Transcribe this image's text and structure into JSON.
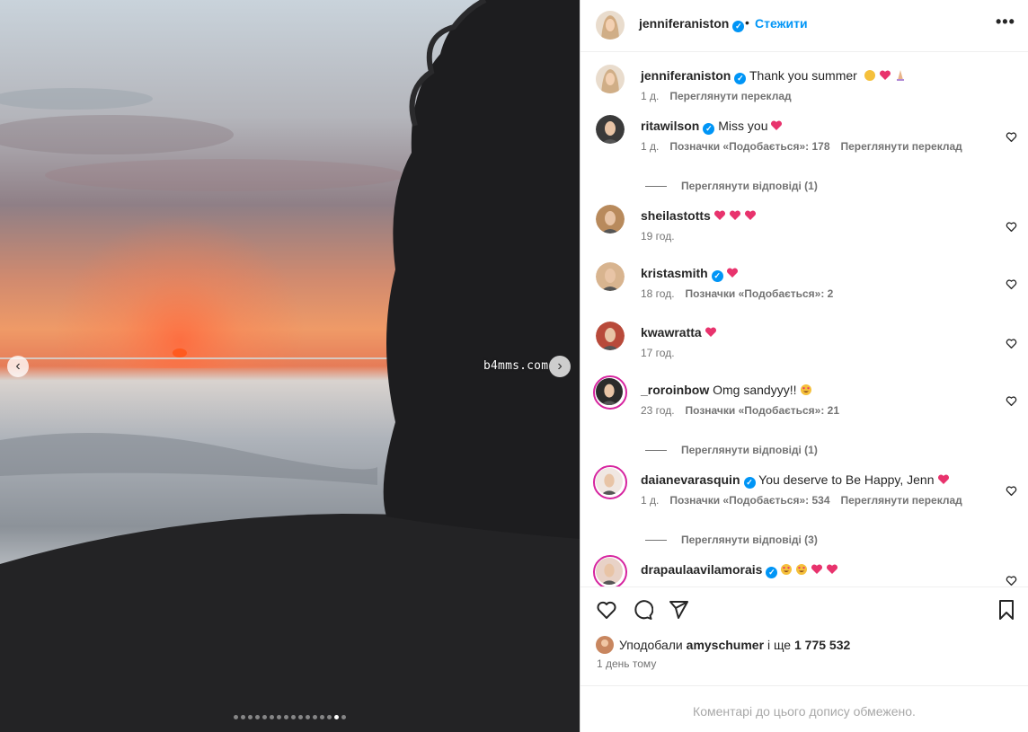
{
  "post": {
    "author": "jenniferaniston",
    "follow_label": "Стежити",
    "separator": "•",
    "more_label": "•••",
    "caption": "Thank you summer",
    "caption_time": "1 д.",
    "caption_translate": "Переглянути переклад"
  },
  "media": {
    "watermark": "b4mms.com",
    "prev_icon": "chevron-left-icon",
    "next_icon": "chevron-right-icon",
    "carousel_total": 16,
    "carousel_active": 15
  },
  "comments": [
    {
      "user": "ritawilson",
      "verified": true,
      "text": "Miss you",
      "emojis": [
        "heart"
      ],
      "time": "1 д.",
      "likes": "Позначки «Подобається»: 178",
      "translate": "Переглянути переклад",
      "replies": "Переглянути відповіді (1)"
    },
    {
      "user": "sheilastotts",
      "verified": false,
      "text": "",
      "emojis": [
        "heart",
        "heart",
        "heart"
      ],
      "time": "19 год.",
      "likes": "",
      "translate": "",
      "replies": ""
    },
    {
      "user": "kristasmith",
      "verified": true,
      "text": "",
      "emojis": [
        "heart"
      ],
      "time": "18 год.",
      "likes": "Позначки «Подобається»: 2",
      "translate": "",
      "replies": ""
    },
    {
      "user": "kwawratta",
      "verified": false,
      "text": "",
      "emojis": [
        "heart"
      ],
      "time": "17 год.",
      "likes": "",
      "translate": "",
      "replies": ""
    },
    {
      "user": "_roroinbow",
      "verified": false,
      "text": "Omg sandyyy!!",
      "emojis": [
        "heart-eyes"
      ],
      "time": "23 год.",
      "likes": "Позначки «Подобається»: 21",
      "translate": "",
      "replies": "Переглянути відповіді (1)"
    },
    {
      "user": "daianevarasquin",
      "verified": true,
      "text": "You deserve to Be Happy, Jenn",
      "emojis": [
        "heart"
      ],
      "time": "1 д.",
      "likes": "Позначки «Подобається»: 534",
      "translate": "Переглянути переклад",
      "replies": "Переглянути відповіді (3)"
    },
    {
      "user": "drapaulaavilamorais",
      "verified": true,
      "text": "",
      "emojis": [
        "heart-eyes",
        "heart-eyes",
        "heart",
        "heart"
      ],
      "time": "",
      "likes": "",
      "translate": "",
      "replies": ""
    }
  ],
  "engagement": {
    "liked_by_prefix": "Уподобали",
    "liked_by_user": "amyschumer",
    "liked_by_and": "і ще",
    "liked_by_count": "1 775 532",
    "time_ago": "1 день тому",
    "restricted": "Коментарі до цього допису обмежено."
  },
  "colors": {
    "accent": "#0095f6",
    "heart": "#ed4956",
    "muted": "#737373"
  }
}
